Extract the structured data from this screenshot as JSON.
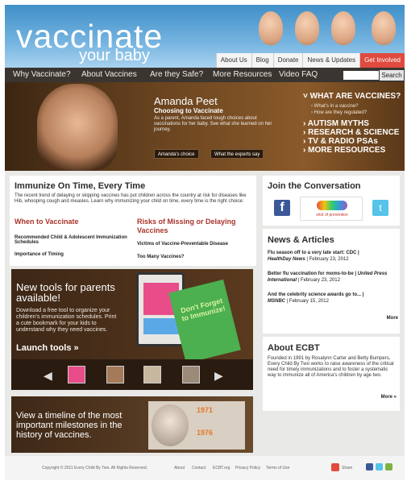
{
  "brand": {
    "line1": "vaccinate",
    "line2": "your baby"
  },
  "top_links": [
    "About Us",
    "Blog",
    "Donate",
    "News & Updates",
    "Get Involved"
  ],
  "main_nav": [
    "Why Vaccinate?",
    "About Vaccines",
    "Are they Safe?",
    "More Resources",
    "Video FAQ"
  ],
  "search": {
    "button": "Search",
    "placeholder": ""
  },
  "hero": {
    "name": "Amanda Peet",
    "subtitle": "Choosing to Vaccinate",
    "desc": "As a parent, Amanda faced tough choices about vaccinations for her baby. See what she learned on her journey.",
    "btn1": "Amanda's choice",
    "btn2": "What the experts say",
    "what_title": "WHAT ARE VACCINES?",
    "what_sub1": "What's in a vaccine?",
    "what_sub2": "How are they regulated?",
    "links": [
      "AUTISM MYTHS",
      "RESEARCH & SCIENCE",
      "TV & RADIO PSAs",
      "MORE RESOURCES"
    ]
  },
  "immunize": {
    "title": "Immunize On Time, Every Time",
    "intro": "The recent trend of delaying or skipping vaccines has put children across the country at risk for diseases like Hib, whooping cough and measles. Learn why immunizing your child on time, every time is the right choice:",
    "col1_title": "When to Vaccinate",
    "col1_links": [
      "Recommended Child & Adolescent Immunization Schedules",
      "Importance of Timing"
    ],
    "col2_title": "Risks of Missing or Delaying Vaccines",
    "col2_links": [
      "Victims of Vaccine-Preventable Disease",
      "Too Many Vaccines?"
    ]
  },
  "tools": {
    "title": "New tools for parents available!",
    "desc": "Download a free tool to organize your children's immunization schedules. Print a cute bookmark for your kids to understand why they need vaccines.",
    "launch": "Launch tools »",
    "card_text": "Don't Forget to Immunize!"
  },
  "timeline": {
    "title": "View a timeline of the most important milestones in the history of vaccines.",
    "years": [
      "1971",
      "1976"
    ]
  },
  "conversation": {
    "title": "Join the Conversation",
    "shot": "shot of prevention"
  },
  "news": {
    "title": "News & Articles",
    "items": [
      {
        "headline": "Flu season off to a very late start: CDC |",
        "source": "HealthDay News",
        "date": "| February 23, 2012"
      },
      {
        "headline": "Better flu vaccination for moms-to-be |",
        "source": "United Press International",
        "date": "| February 23, 2012"
      },
      {
        "headline": "And the celebrity science awards go to... |",
        "source": "MSNBC",
        "date": "| February 15, 2012"
      }
    ],
    "more": "More"
  },
  "about": {
    "title": "About ECBT",
    "text": "Founded in 1991 by Rosalynn Carter and Betty Bumpers, Every Child By Two works to raise awareness of the critical need for timely immunizations and to foster a systematic way to immunize all of America's children by age two.",
    "more": "More »"
  },
  "footer": {
    "copyright": "Copyright © 2011 Every Child By Two. All Rights Reserved.",
    "links": [
      "About",
      "Contact",
      "ECBT.org",
      "Privacy Policy",
      "Terms of Use"
    ],
    "share": "Share"
  }
}
